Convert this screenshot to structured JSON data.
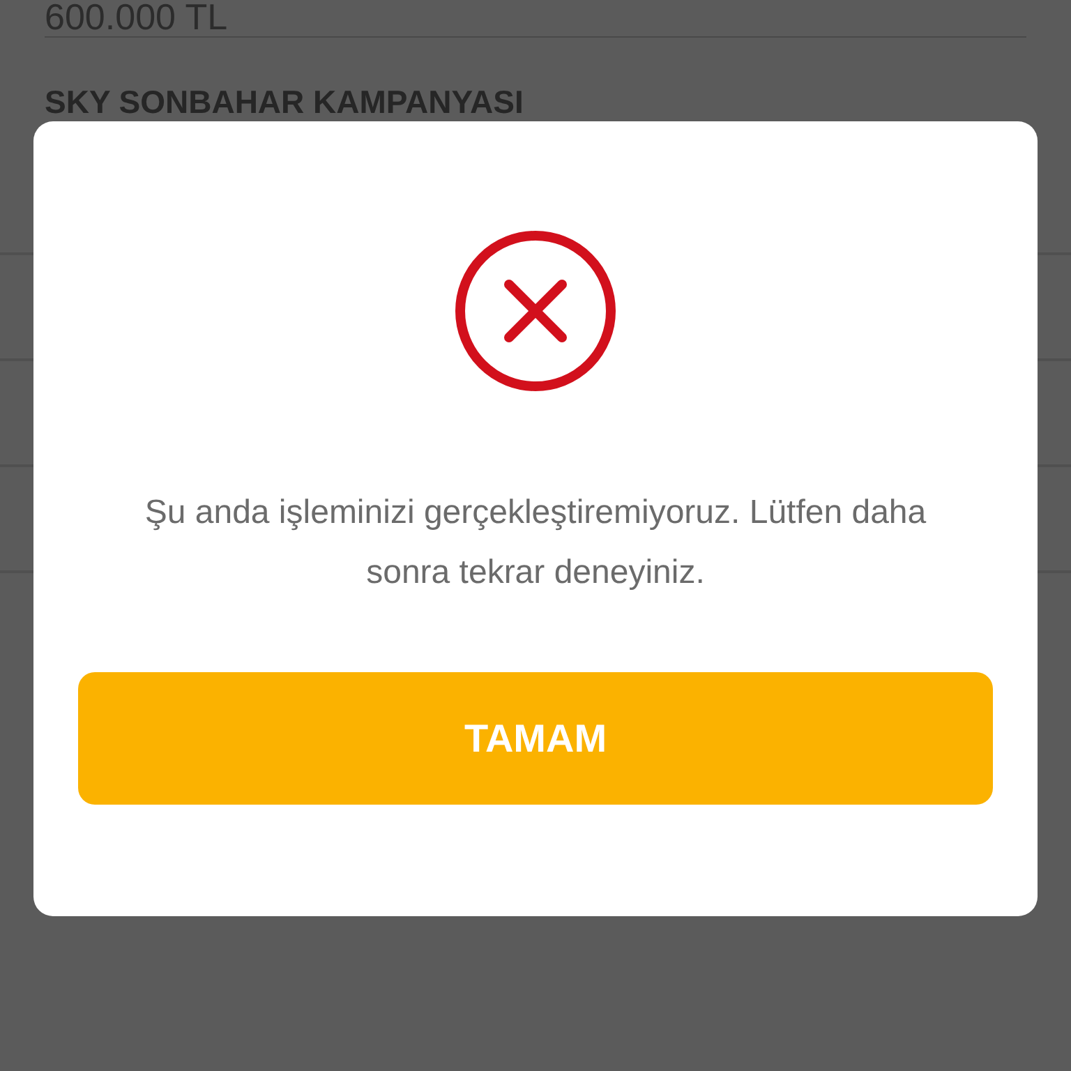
{
  "page": {
    "amount": "600.000 TL",
    "campaign_title": "SKY SONBAHAR KAMPANYASI"
  },
  "dialog": {
    "kind": "error",
    "message": "Şu anda işleminizi gerçekleştiremiyoruz. Lütfen daha sonra tekrar deneyiniz.",
    "button": "TAMAM"
  }
}
